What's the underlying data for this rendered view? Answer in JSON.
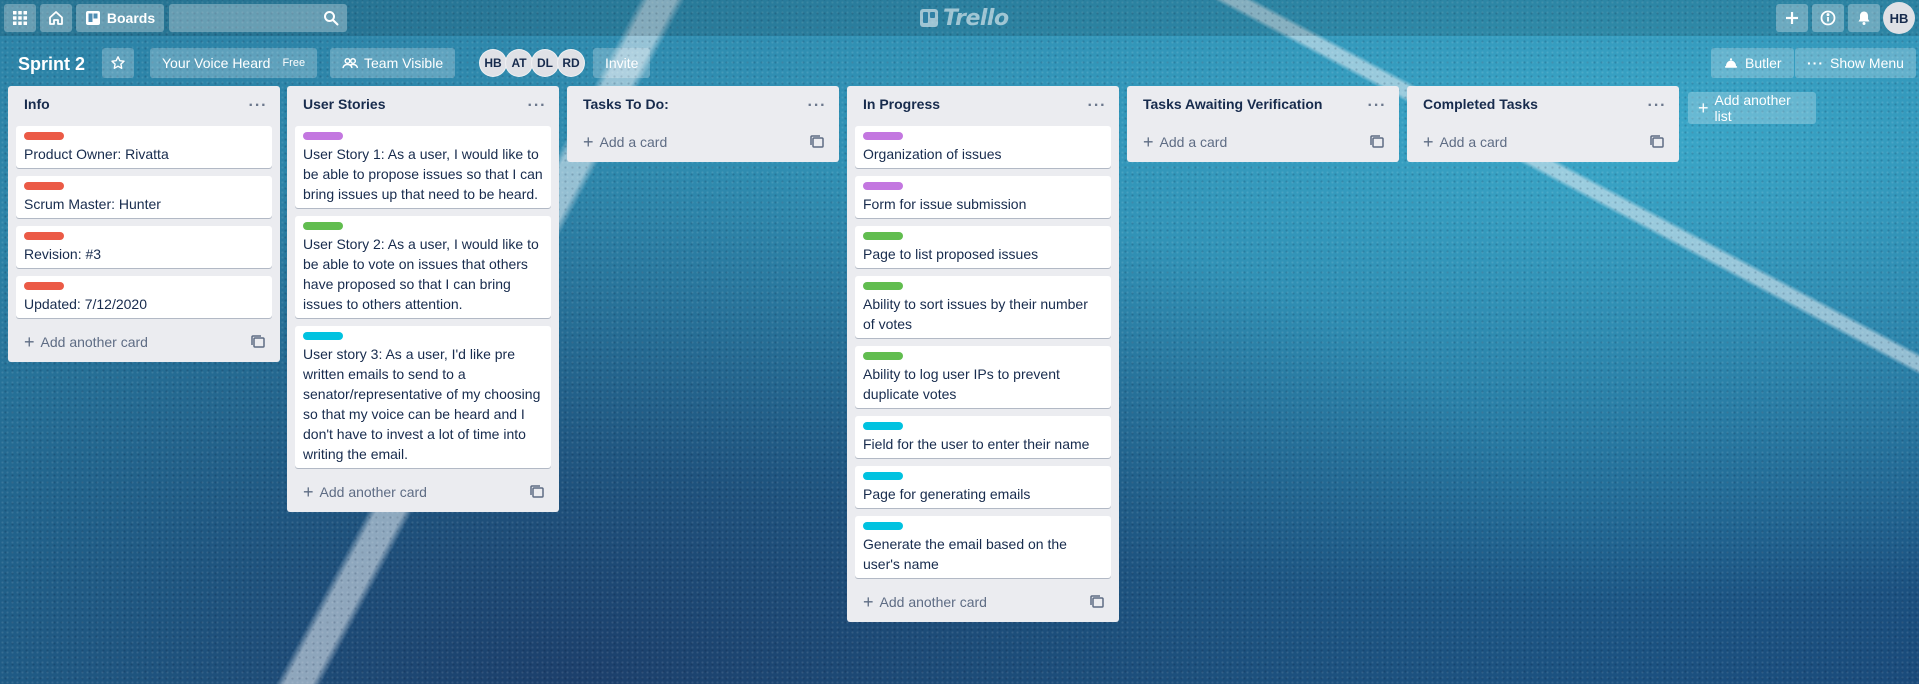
{
  "header": {
    "boards_label": "Boards",
    "search_placeholder": "",
    "logo_text": "Trello",
    "user_initials": "HB"
  },
  "board": {
    "title": "Sprint 2",
    "team_name": "Your Voice Heard",
    "team_badge": "Free",
    "visibility": "Team Visible",
    "members": [
      "HB",
      "AT",
      "DL",
      "RD"
    ],
    "invite_label": "Invite",
    "butler_label": "Butler",
    "show_menu_label": "Show Menu",
    "add_list_label": "Add another list"
  },
  "lists": [
    {
      "title": "Info",
      "add_label": "Add another card",
      "cards": [
        {
          "label_color": "#eb5a46",
          "text": "Product Owner: Rivatta"
        },
        {
          "label_color": "#eb5a46",
          "text": "Scrum Master: Hunter"
        },
        {
          "label_color": "#eb5a46",
          "text": "Revision: #3"
        },
        {
          "label_color": "#eb5a46",
          "text": "Updated: 7/12/2020"
        }
      ]
    },
    {
      "title": "User Stories",
      "add_label": "Add another card",
      "cards": [
        {
          "label_color": "#c377e0",
          "text": "User Story 1: As a user, I would like to be able to propose issues so that I can bring issues up that need to be heard."
        },
        {
          "label_color": "#61bd4f",
          "text": "User Story 2: As a user, I would like to be able to vote on issues that others have proposed so that I can bring issues to others attention."
        },
        {
          "label_color": "#00c2e0",
          "text": "User story 3: As a user, I'd like pre written emails to send to a senator/representative of my choosing so that my voice can be heard and I don't have to invest a lot of time into writing the email."
        }
      ]
    },
    {
      "title": "Tasks To Do:",
      "add_label": "Add a card",
      "cards": []
    },
    {
      "title": "In Progress",
      "add_label": "Add another card",
      "cards": [
        {
          "label_color": "#c377e0",
          "text": "Organization of issues"
        },
        {
          "label_color": "#c377e0",
          "text": "Form for issue submission"
        },
        {
          "label_color": "#61bd4f",
          "text": "Page to list proposed issues"
        },
        {
          "label_color": "#61bd4f",
          "text": "Ability to sort issues by their number of votes"
        },
        {
          "label_color": "#61bd4f",
          "text": "Ability to log user IPs to prevent duplicate votes"
        },
        {
          "label_color": "#00c2e0",
          "text": "Field for the user to enter their name"
        },
        {
          "label_color": "#00c2e0",
          "text": "Page for generating emails"
        },
        {
          "label_color": "#00c2e0",
          "text": "Generate the email based on the user's name"
        }
      ]
    },
    {
      "title": "Tasks Awaiting Verification",
      "add_label": "Add a card",
      "cards": []
    },
    {
      "title": "Completed Tasks",
      "add_label": "Add a card",
      "cards": []
    }
  ]
}
